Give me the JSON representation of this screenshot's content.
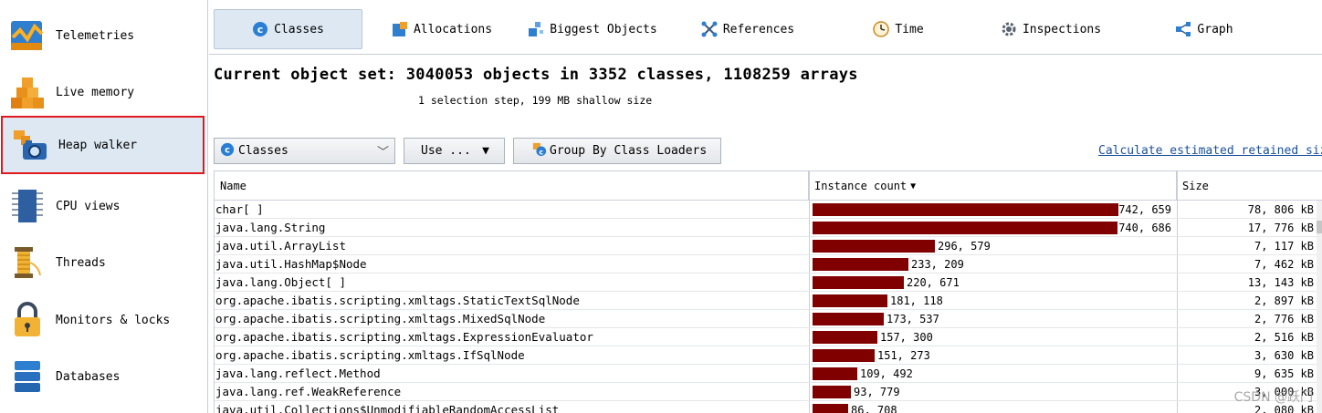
{
  "sidebar": {
    "items": [
      {
        "label": "Telemetries",
        "icon": "telemetries-icon"
      },
      {
        "label": "Live memory",
        "icon": "live-memory-icon"
      },
      {
        "label": "Heap walker",
        "icon": "heap-walker-icon",
        "selected": true
      },
      {
        "label": "CPU views",
        "icon": "cpu-views-icon"
      },
      {
        "label": "Threads",
        "icon": "threads-icon"
      },
      {
        "label": "Monitors & locks",
        "icon": "lock-icon"
      },
      {
        "label": "Databases",
        "icon": "database-icon"
      }
    ]
  },
  "tabs": [
    {
      "label": "Classes",
      "icon": "classes-icon",
      "active": true
    },
    {
      "label": "Allocations",
      "icon": "allocations-icon"
    },
    {
      "label": "Biggest Objects",
      "icon": "biggest-objects-icon"
    },
    {
      "label": "References",
      "icon": "references-icon"
    },
    {
      "label": "Time",
      "icon": "clock-icon"
    },
    {
      "label": "Inspections",
      "icon": "gear-icon"
    },
    {
      "label": "Graph",
      "icon": "graph-icon"
    }
  ],
  "heading": "Current object set: 3040053 objects in 3352 classes, 1108259 arrays",
  "subheading": "1 selection step, 199 MB shallow size",
  "toolbar": {
    "view_select": "Classes",
    "use_button": "Use ...",
    "group_button": "Group By Class Loaders",
    "retained_link": "Calculate estimated retained sizes"
  },
  "table": {
    "columns": {
      "name": "Name",
      "count": "Instance count",
      "size": "Size"
    },
    "max_count": 742659,
    "rows": [
      {
        "name": "char[ ]",
        "count": 742659,
        "count_label": "742, 659",
        "size": "78, 806 kB"
      },
      {
        "name": "java.lang.String",
        "count": 740686,
        "count_label": "740, 686",
        "size": "17, 776 kB"
      },
      {
        "name": "java.util.ArrayList",
        "count": 296579,
        "count_label": "296, 579",
        "size": "7, 117 kB"
      },
      {
        "name": "java.util.HashMap$Node",
        "count": 233209,
        "count_label": "233, 209",
        "size": "7, 462 kB"
      },
      {
        "name": "java.lang.Object[ ]",
        "count": 220671,
        "count_label": "220, 671",
        "size": "13, 143 kB"
      },
      {
        "name": "org.apache.ibatis.scripting.xmltags.StaticTextSqlNode",
        "count": 181118,
        "count_label": "181, 118",
        "size": "2, 897 kB"
      },
      {
        "name": "org.apache.ibatis.scripting.xmltags.MixedSqlNode",
        "count": 173537,
        "count_label": "173, 537",
        "size": "2, 776 kB"
      },
      {
        "name": "org.apache.ibatis.scripting.xmltags.ExpressionEvaluator",
        "count": 157300,
        "count_label": "157, 300",
        "size": "2, 516 kB"
      },
      {
        "name": "org.apache.ibatis.scripting.xmltags.IfSqlNode",
        "count": 151273,
        "count_label": "151, 273",
        "size": "3, 630 kB"
      },
      {
        "name": "java.lang.reflect.Method",
        "count": 109492,
        "count_label": "109, 492",
        "size": "9, 635 kB"
      },
      {
        "name": "java.lang.ref.WeakReference",
        "count": 93779,
        "count_label": "93, 779",
        "size": "3, 000 kB"
      },
      {
        "name": "java.util.Collections$UnmodifiableRandomAccessList",
        "count": 86708,
        "count_label": "86, 708",
        "size": "2, 080 kB"
      }
    ]
  },
  "watermark": "CSDN @跃门",
  "colors": {
    "bar": "#800000",
    "selection_border": "#e0191e",
    "active_bg": "#dde8f3",
    "link": "#1a4f9e"
  }
}
